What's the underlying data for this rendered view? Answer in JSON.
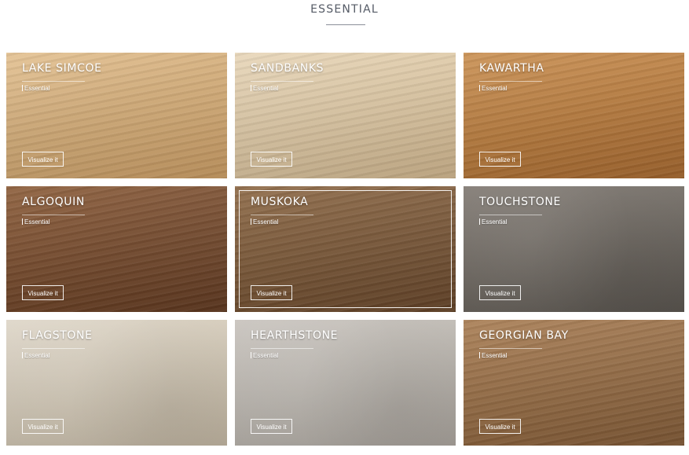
{
  "section": {
    "title": "ESSENTIAL"
  },
  "tiles": [
    {
      "name": "LAKE SIMCOE",
      "collection": "Essential",
      "button": "Visualize it"
    },
    {
      "name": "SANDBANKS",
      "collection": "Essential",
      "button": "Visualize it"
    },
    {
      "name": "KAWARTHA",
      "collection": "Essential",
      "button": "Visualize it"
    },
    {
      "name": "ALGOQUIN",
      "collection": "Essential",
      "button": "Visualize it"
    },
    {
      "name": "MUSKOKA",
      "collection": "Essential",
      "button": "Visualize it"
    },
    {
      "name": "TOUCHSTONE",
      "collection": "Essential",
      "button": "Visualize it"
    },
    {
      "name": "FLAGSTONE",
      "collection": "Essential",
      "button": "Visualize it"
    },
    {
      "name": "HEARTHSTONE",
      "collection": "Essential",
      "button": "Visualize it"
    },
    {
      "name": "GEORGIAN BAY",
      "collection": "Essential",
      "button": "Visualize it"
    }
  ],
  "colors": {
    "title_text": "#555b66",
    "tile_text": "#ffffff",
    "lake_simcoe": "#d4ac77",
    "sandbanks": "#dcc6a2",
    "kawartha": "#b87a3b",
    "algoquin": "#74482a",
    "muskoka": "#785535",
    "touchstone": "#6e6861",
    "flagstone": "#d2c8b6",
    "hearthstone": "#bbb6af",
    "georgian_bay": "#946a42"
  }
}
